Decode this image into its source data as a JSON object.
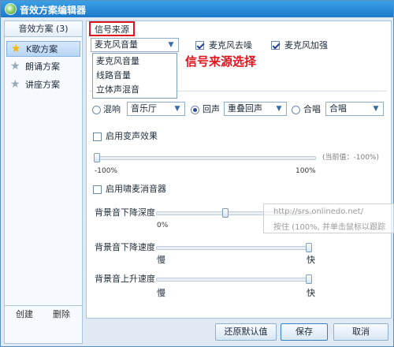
{
  "window": {
    "title": "音效方案编辑器"
  },
  "sidebar": {
    "header": "音效方案 (3)",
    "items": [
      {
        "label": "K歌方案",
        "active": true
      },
      {
        "label": "朗诵方案",
        "active": false
      },
      {
        "label": "讲座方案",
        "active": false
      }
    ],
    "create_label": "创建",
    "delete_label": "删除"
  },
  "signal_source": {
    "title": "信号来源",
    "selected": "麦克风音量",
    "options": [
      "麦克风音量",
      "线路音量",
      "立体声混音"
    ],
    "annotation": "信号来源选择",
    "mic_denoise": {
      "label": "麦克风去噪",
      "checked": true
    },
    "mic_boost": {
      "label": "麦克风加强",
      "checked": true
    }
  },
  "effects": {
    "reverb": {
      "label": "混响",
      "selected": false,
      "value": "音乐厅"
    },
    "echo": {
      "label": "回声",
      "selected": true,
      "value": "重叠回声"
    },
    "chorus": {
      "label": "合唱",
      "selected": false,
      "value": "合唱"
    }
  },
  "voice_change": {
    "label": "启用变声效果",
    "checked": false,
    "min_label": "-100%",
    "max_label": "100%",
    "current_label": "(当前值：-100%)",
    "value_percent": -100
  },
  "whistle": {
    "label": "启用啸麦消音器",
    "checked": false
  },
  "bg_drop_depth": {
    "label": "背景音下降深度",
    "low": "0%",
    "value_fraction": 0.45
  },
  "bg_drop_speed": {
    "label": "背景音下降速度",
    "low": "慢",
    "high": "快",
    "value_fraction": 1.0
  },
  "bg_rise_speed": {
    "label": "背景音上升速度",
    "low": "慢",
    "high": "快",
    "value_fraction": 1.0
  },
  "watermark": {
    "line1": "http://srs.onlinedo.net/",
    "line2": "按住 (100%, 并单击鼠标以跟踪"
  },
  "buttons": {
    "restore": "还原默认值",
    "save": "保存",
    "cancel": "取消"
  }
}
